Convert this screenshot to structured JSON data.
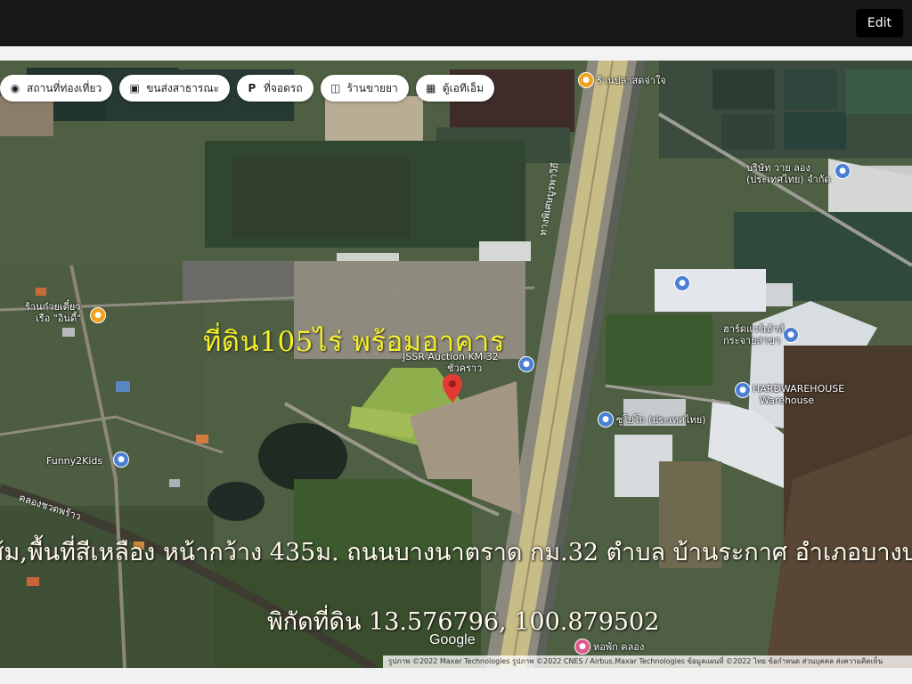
{
  "toolbar": {
    "edit_label": "Edit"
  },
  "chips": [
    {
      "label": "สถานที่ท่องเที่ยว",
      "icon": "camera-icon"
    },
    {
      "label": "ขนส่งสาธารณะ",
      "icon": "bus-icon"
    },
    {
      "label": "ที่จอดรถ",
      "icon": "parking-icon"
    },
    {
      "label": "ร้านขายยา",
      "icon": "pharmacy-icon"
    },
    {
      "label": "ตู้เอทีเอ็ม",
      "icon": "atm-icon"
    }
  ],
  "overlay": {
    "title": "ที่ดิน105ไร่ พร้อมอาคาร",
    "line1": "ส้ม,พื้นที่สีเหลือง หน้ากว้าง 435ม. ถนนบางนาตราด กม.32 ตำบล บ้านระกาศ อำเภอบางบ่อ สมุ",
    "line2": "พิกัดที่ดิน 13.576796, 100.879502"
  },
  "pois": {
    "top_shop": "ร้านปลาสดจ่าใจ",
    "noodle": [
      "ร้านก๋วยเตี๋ยว",
      "เรือ \"อินดี้\""
    ],
    "auction": [
      "JSSR Auction KM 32",
      "ชั่วคราว"
    ],
    "funny": "Funny2Kids",
    "company_top": [
      "บริษัท วาย ลอง",
      "(ประเทศไทย) จำกัด"
    ],
    "warehouse_branch": [
      "ฮาร์ดแวร์เฮ้าส์",
      "กระจายสาขา"
    ],
    "hardware": [
      "HARDWAREHOUSE",
      "Warehouse"
    ],
    "company_mid": "ซูโยโก (ประเทศไทย)",
    "hall": "หอพัก คลอง"
  },
  "roads": {
    "highway": "ทางพิเศษบูรพาวิถี",
    "canal": "คลองชวดพร้าว"
  },
  "map_brand": "Google",
  "attribution": "รูปภาพ ©2022 Maxar Technologies รูปภาพ ©2022 CNES / Airbus,Maxar Technologies ข้อมูลแผนที่ ©2022   ไทย   ข้อกำหนด   ส่วนบุคคล   ส่งความคิดเห็น",
  "colors": {
    "topbar": "#171717",
    "title_yellow": "#f4ef2a",
    "pin_red": "#e53935",
    "poi_blue": "#4a7fd4",
    "poi_orange": "#f2a01c"
  }
}
